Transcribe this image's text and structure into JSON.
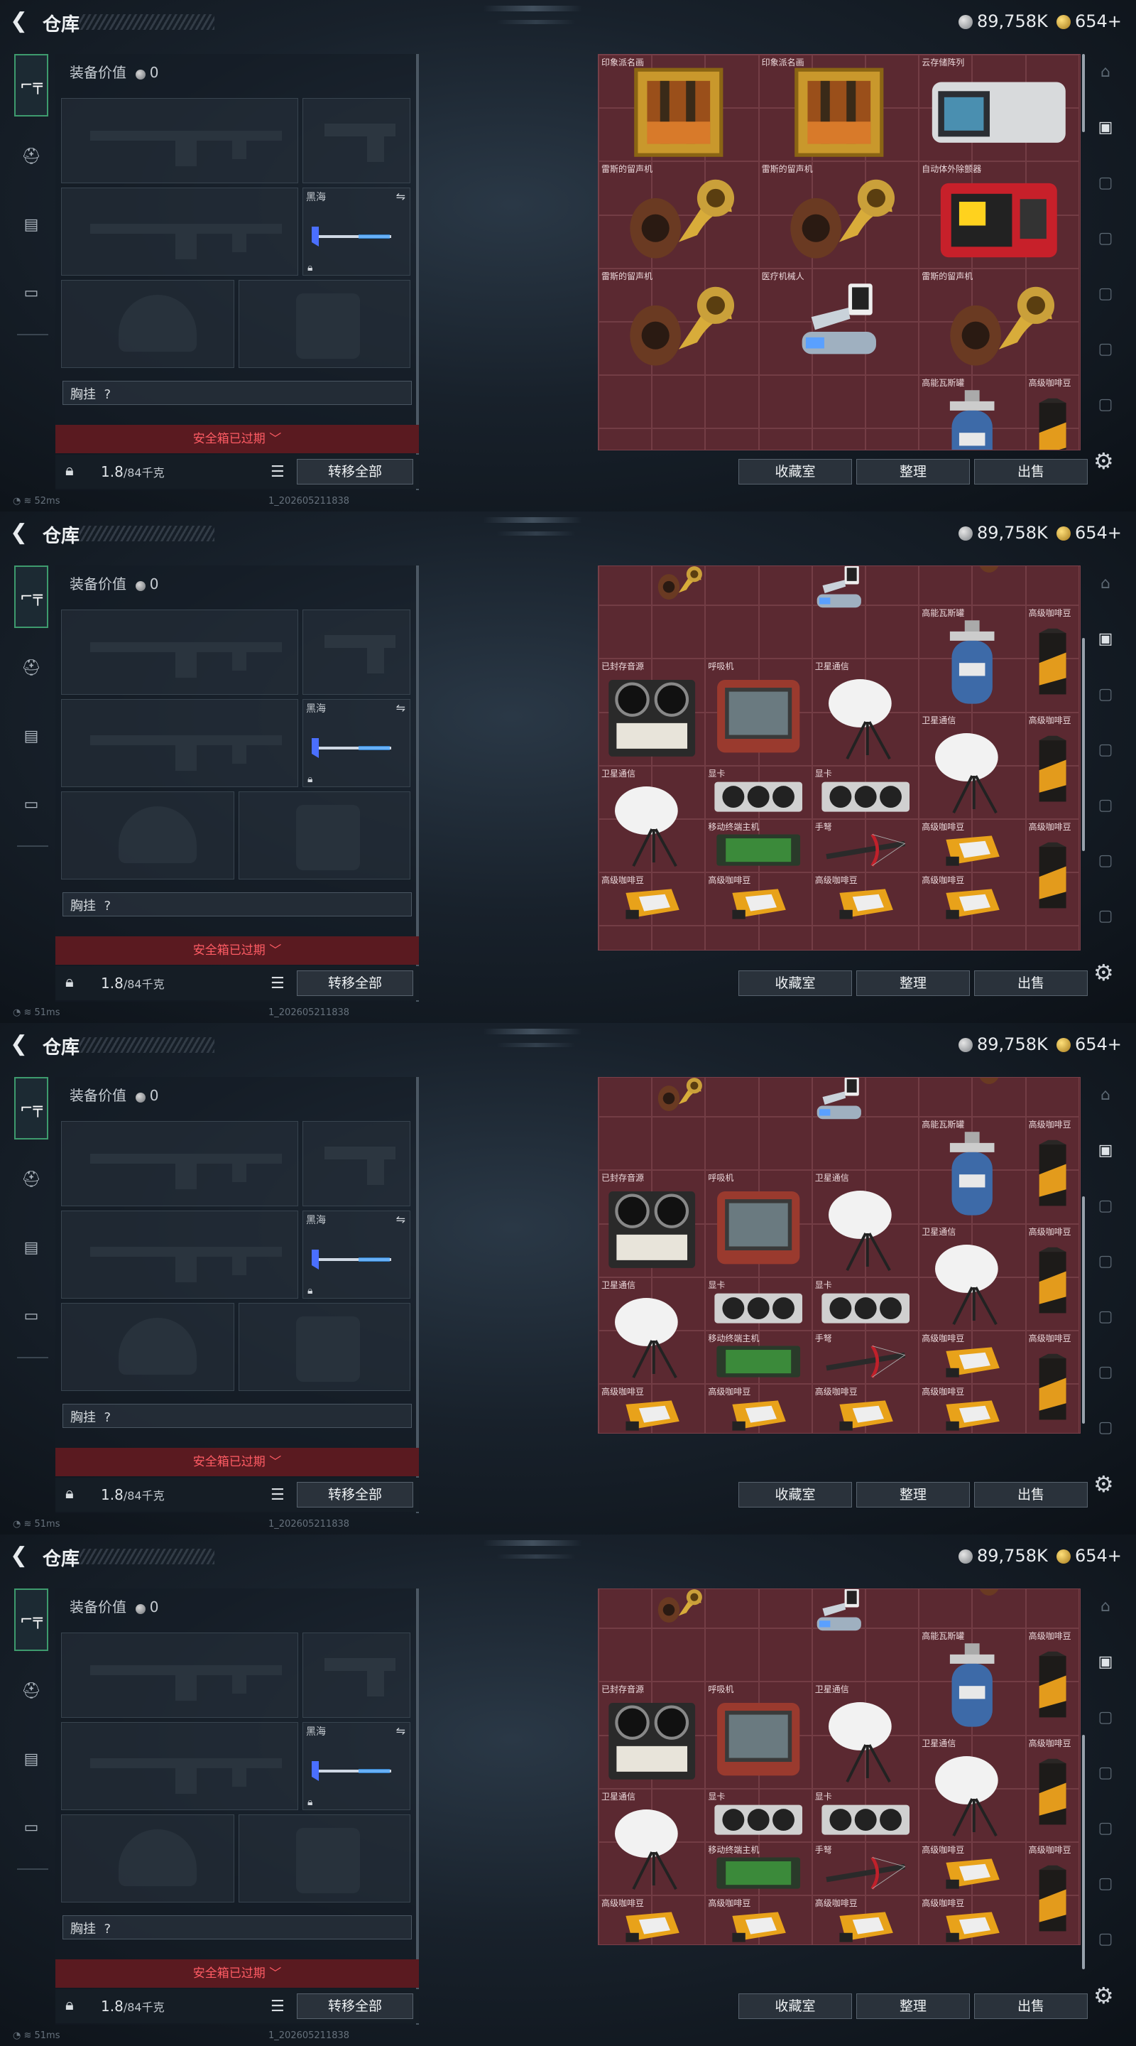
{
  "header": {
    "back_icon": "chevron-left-icon",
    "title": "仓库",
    "currency1": "89,758K",
    "currency2": "654+"
  },
  "equip": {
    "value_label": "装备价值",
    "value_amount": "0",
    "melee_label": "黑海",
    "chest_label": "胸挂",
    "chest_value": "?",
    "safe_box_text": "安全箱已过期",
    "weight": "1.8",
    "weight_max": "/84千克",
    "transfer_all": "转移全部"
  },
  "grid_buttons": {
    "collection": "收藏室",
    "organize": "整理",
    "sell": "出售"
  },
  "status": {
    "ping": [
      "52ms",
      "51ms",
      "51ms",
      "51ms"
    ],
    "build": "1_202605211838"
  },
  "items": {
    "painting": "印象派名画",
    "storage_array": "云存储阵列",
    "defibrillator": "自动体外除颤器",
    "phonograph": "雷斯的留声机",
    "medical_arm": "医疗机械人",
    "gas_tank": "高能瓦斯罐",
    "coffee": "高级咖啡豆",
    "reel_recorder": "已封存音源",
    "ventilator": "呼吸机",
    "satellite": "卫星通信",
    "gpu": "显卡",
    "mobile_terminal": "移动终端主机",
    "crossbow": "手弩"
  },
  "colors": {
    "grid_bg": "#5b2931",
    "safe_bg": "#5a1a20",
    "safe_text": "#ff5c64",
    "active_tab": "#3e9b6e"
  }
}
